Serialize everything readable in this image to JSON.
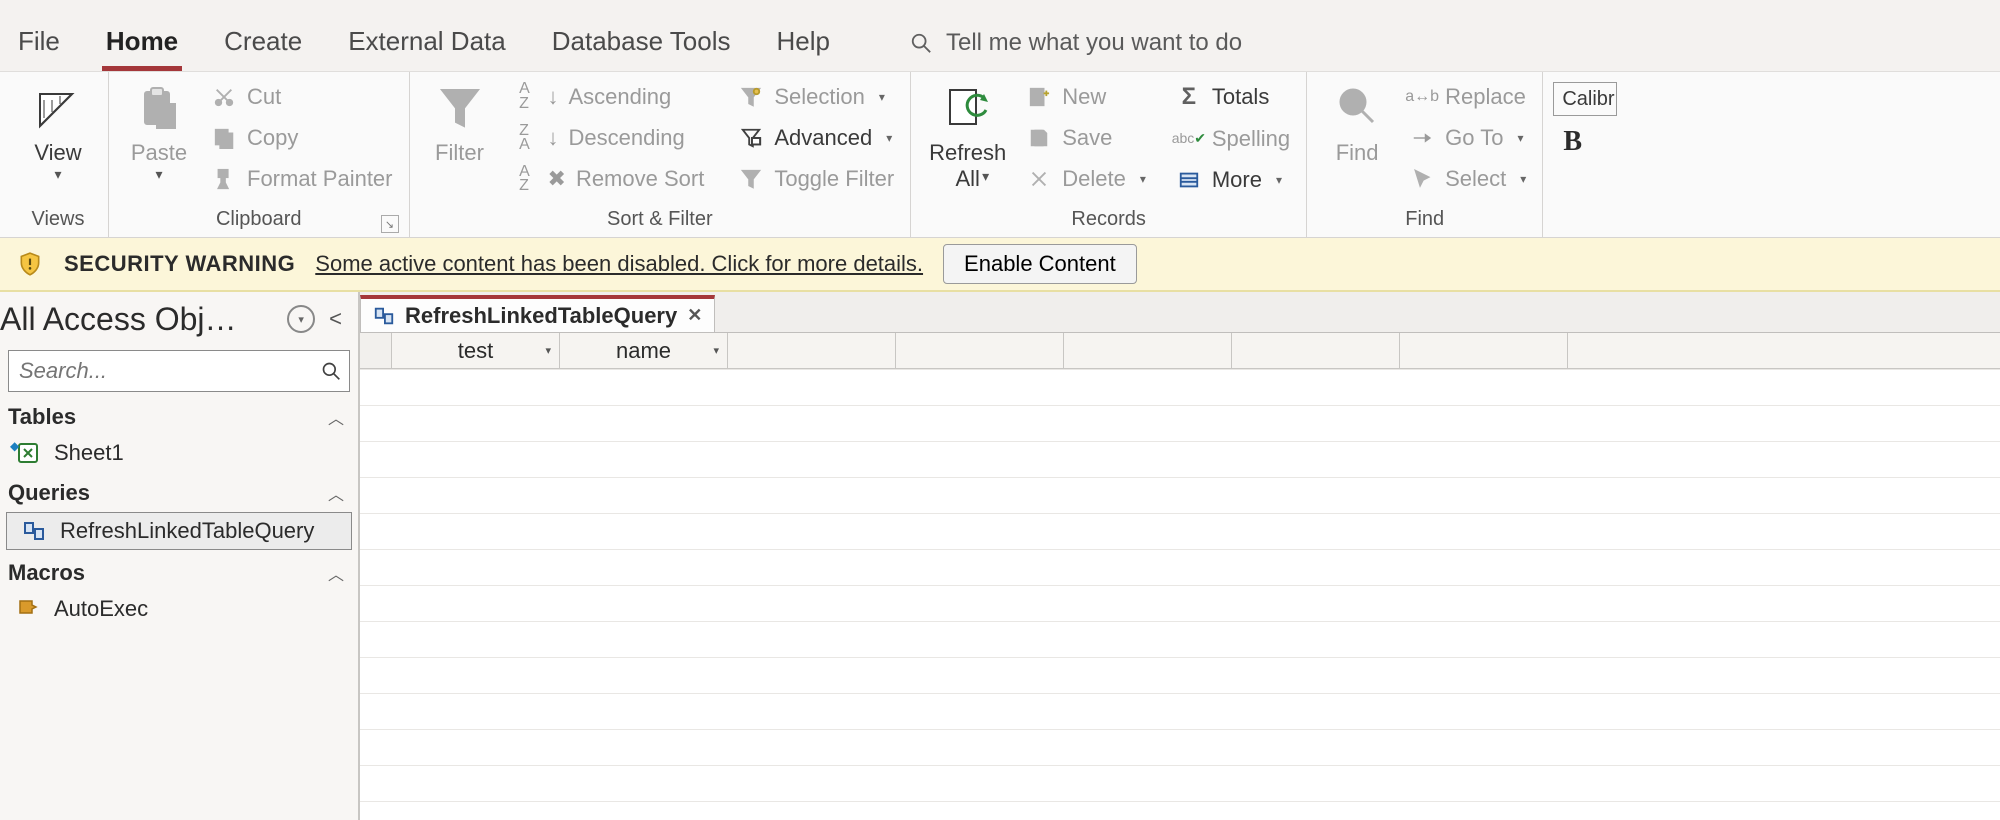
{
  "ribbonTabs": {
    "file": "File",
    "home": "Home",
    "create": "Create",
    "external": "External Data",
    "dbtools": "Database Tools",
    "help": "Help"
  },
  "tellme": {
    "placeholder": "Tell me what you want to do"
  },
  "groups": {
    "views": {
      "label": "Views",
      "view": "View"
    },
    "clipboard": {
      "label": "Clipboard",
      "paste": "Paste",
      "cut": "Cut",
      "copy": "Copy",
      "formatPainter": "Format Painter"
    },
    "sortfilter": {
      "label": "Sort & Filter",
      "filter": "Filter",
      "ascending": "Ascending",
      "descending": "Descending",
      "removeSort": "Remove Sort",
      "selection": "Selection",
      "advanced": "Advanced",
      "toggleFilter": "Toggle Filter"
    },
    "records": {
      "label": "Records",
      "refreshAll": "Refresh\nAll",
      "new": "New",
      "save": "Save",
      "delete": "Delete",
      "totals": "Totals",
      "spelling": "Spelling",
      "more": "More"
    },
    "find": {
      "label": "Find",
      "find": "Find",
      "replace": "Replace",
      "goto": "Go To",
      "select": "Select"
    },
    "textfmt": {
      "font": "Calibr",
      "bold": "B"
    }
  },
  "securityBar": {
    "title": "SECURITY WARNING",
    "message": "Some active content has been disabled. Click for more details.",
    "button": "Enable Content"
  },
  "navPane": {
    "title": "All Access Obj…",
    "searchPlaceholder": "Search...",
    "groups": {
      "tables": {
        "label": "Tables",
        "items": [
          "Sheet1"
        ]
      },
      "queries": {
        "label": "Queries",
        "items": [
          "RefreshLinkedTableQuery"
        ]
      },
      "macros": {
        "label": "Macros",
        "items": [
          "AutoExec"
        ]
      }
    }
  },
  "document": {
    "tabTitle": "RefreshLinkedTableQuery",
    "columns": [
      "test",
      "name"
    ]
  }
}
